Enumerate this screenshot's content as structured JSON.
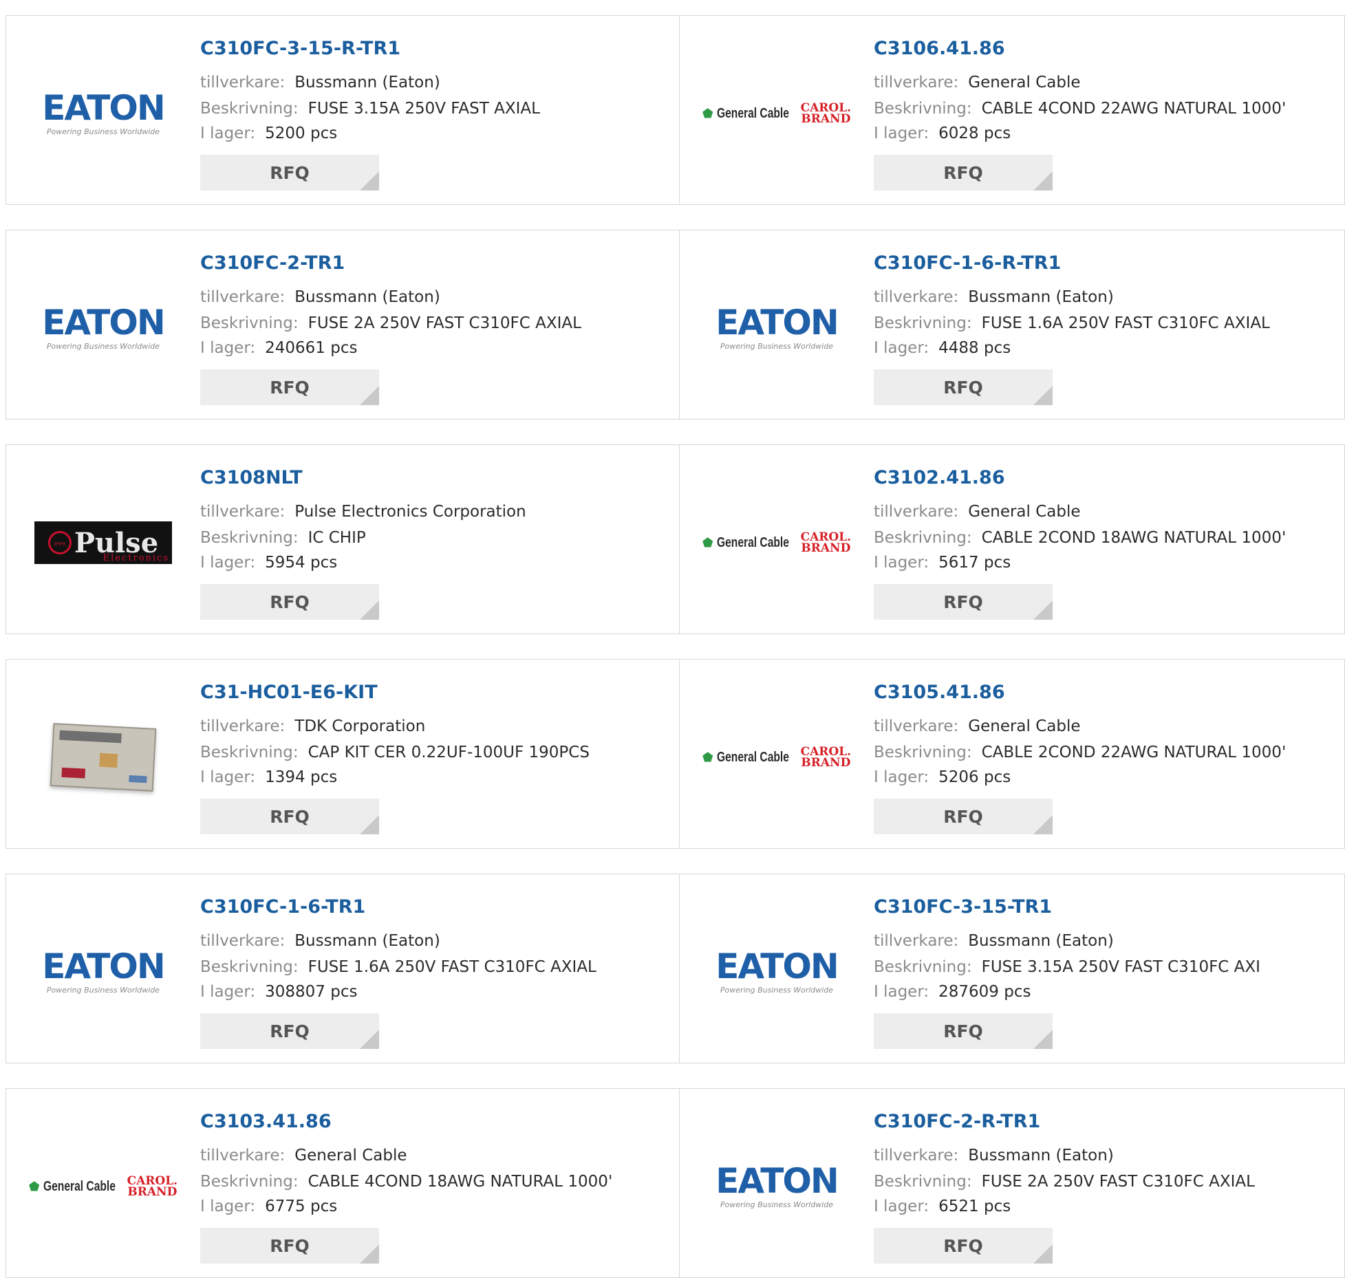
{
  "labels": {
    "manufacturer": "tillverkare:",
    "description": "Beskrivning:",
    "stock": "I lager:",
    "rfq": "RFQ"
  },
  "logos": {
    "eaton": {
      "wordmark": "EATON",
      "tagline": "Powering Business Worldwide"
    },
    "general_cable": {
      "name": "General Cable",
      "brand": "CAROL. BRAND",
      "brand_line1": "CAROL.",
      "brand_line2": "BRAND"
    },
    "pulse": {
      "name": "Pulse",
      "sub": "Electronics"
    },
    "tdk_kit": {
      "icon": "component-kit-photo"
    }
  },
  "products": [
    {
      "part": "C310FC-3-15-R-TR1",
      "manufacturer": "Bussmann (Eaton)",
      "description": "FUSE 3.15A 250V FAST AXIAL",
      "stock": "5200 pcs",
      "logo": "eaton"
    },
    {
      "part": "C3106.41.86",
      "manufacturer": "General Cable",
      "description": "CABLE 4COND 22AWG NATURAL 1000'",
      "stock": "6028 pcs",
      "logo": "general_cable"
    },
    {
      "part": "C310FC-2-TR1",
      "manufacturer": "Bussmann (Eaton)",
      "description": "FUSE 2A 250V FAST C310FC AXIAL",
      "stock": "240661 pcs",
      "logo": "eaton"
    },
    {
      "part": "C310FC-1-6-R-TR1",
      "manufacturer": "Bussmann (Eaton)",
      "description": "FUSE 1.6A 250V FAST C310FC AXIAL",
      "stock": "4488 pcs",
      "logo": "eaton"
    },
    {
      "part": "C3108NLT",
      "manufacturer": "Pulse Electronics Corporation",
      "description": "IC CHIP",
      "stock": "5954 pcs",
      "logo": "pulse"
    },
    {
      "part": "C3102.41.86",
      "manufacturer": "General Cable",
      "description": "CABLE 2COND 18AWG NATURAL 1000'",
      "stock": "5617 pcs",
      "logo": "general_cable"
    },
    {
      "part": "C31-HC01-E6-KIT",
      "manufacturer": "TDK Corporation",
      "description": "CAP KIT CER 0.22UF-100UF 190PCS",
      "stock": "1394 pcs",
      "logo": "tdk_kit"
    },
    {
      "part": "C3105.41.86",
      "manufacturer": "General Cable",
      "description": "CABLE 2COND 22AWG NATURAL 1000'",
      "stock": "5206 pcs",
      "logo": "general_cable"
    },
    {
      "part": "C310FC-1-6-TR1",
      "manufacturer": "Bussmann (Eaton)",
      "description": "FUSE 1.6A 250V FAST C310FC AXIAL",
      "stock": "308807 pcs",
      "logo": "eaton"
    },
    {
      "part": "C310FC-3-15-TR1",
      "manufacturer": "Bussmann (Eaton)",
      "description": "FUSE 3.15A 250V FAST C310FC AXI",
      "stock": "287609 pcs",
      "logo": "eaton"
    },
    {
      "part": "C3103.41.86",
      "manufacturer": "General Cable",
      "description": "CABLE 4COND 18AWG NATURAL 1000'",
      "stock": "6775 pcs",
      "logo": "general_cable"
    },
    {
      "part": "C310FC-2-R-TR1",
      "manufacturer": "Bussmann (Eaton)",
      "description": "FUSE 2A 250V FAST C310FC AXIAL",
      "stock": "6521 pcs",
      "logo": "eaton"
    }
  ],
  "colors": {
    "part_link": "#1b5e9e",
    "label": "#8a8a8a",
    "value": "#2b2b2b",
    "rfq_bg": "#ededed",
    "eaton_blue": "#1f5fa8",
    "carol_red": "#d62027"
  }
}
